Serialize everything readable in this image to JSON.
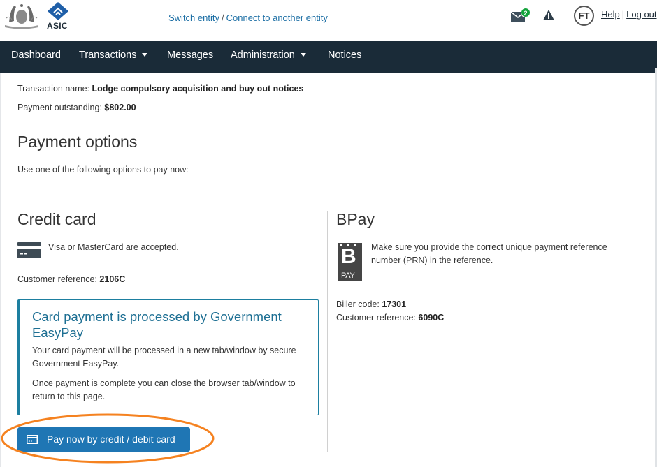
{
  "header": {
    "logo_text": "ASIC",
    "switch_entity_link": "Switch entity",
    "separator": "/",
    "connect_entity_link": "Connect to another entity",
    "mail_badge_count": "2",
    "avatar_initials": "FT",
    "help_link": "Help",
    "help_separator": "|",
    "logout_link": "Log out"
  },
  "nav": {
    "items": [
      {
        "label": "Dashboard",
        "has_dropdown": false
      },
      {
        "label": "Transactions",
        "has_dropdown": true
      },
      {
        "label": "Messages",
        "has_dropdown": false
      },
      {
        "label": "Administration",
        "has_dropdown": true
      },
      {
        "label": "Notices",
        "has_dropdown": false
      }
    ]
  },
  "summary": {
    "transaction_name_label": "Transaction name:",
    "transaction_name_value": "Lodge compulsory acquisition and buy out notices",
    "payment_outstanding_label": "Payment outstanding:",
    "payment_outstanding_value": "$802.00"
  },
  "payment_options": {
    "heading": "Payment options",
    "intro": "Use one of the following options to pay now:"
  },
  "credit_card": {
    "heading": "Credit card",
    "accepted_text": "Visa or MasterCard are accepted.",
    "customer_reference_label": "Customer reference:",
    "customer_reference_value": "2106C",
    "easypay_title": "Card payment is processed by Government EasyPay",
    "easypay_p1": "Your card payment will be processed in a new tab/window by secure Government EasyPay.",
    "easypay_p2": "Once payment is complete you can close the browser tab/window to return to this page.",
    "pay_button_label": "Pay now by credit / debit card"
  },
  "bpay": {
    "heading": "BPay",
    "logo_text": "PAY",
    "instructions": "Make sure you provide the correct unique payment reference number (PRN) in the reference.",
    "biller_code_label": "Biller code:",
    "biller_code_value": "17301",
    "customer_reference_label": "Customer reference:",
    "customer_reference_value": "6090C"
  },
  "colors": {
    "navbar_bg": "#1a2b38",
    "link": "#1d6fa5",
    "button_bg": "#1f76b4",
    "info_box_border": "#1d7fa0",
    "badge_green": "#14a33c",
    "annotation": "#f58220"
  }
}
